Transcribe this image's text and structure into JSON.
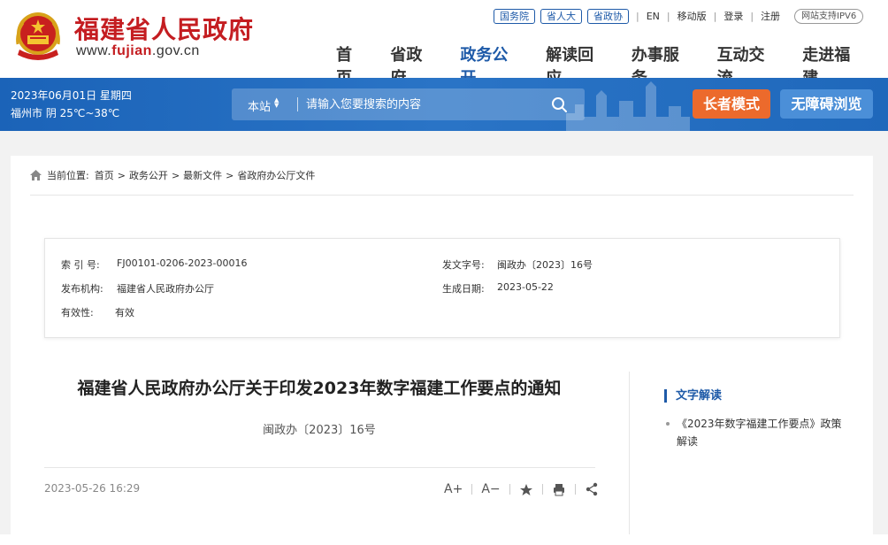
{
  "header": {
    "site_name": "福建省人民政府",
    "site_url_prefix": "www.",
    "site_url_brand": "fujian",
    "site_url_suffix": ".gov.cn",
    "top_pills": [
      "国务院",
      "省人大",
      "省政协"
    ],
    "lang_en": "EN",
    "mobile": "移动版",
    "login": "登录",
    "register": "注册",
    "ipv6": "网站支持IPV6",
    "nav": [
      {
        "label": "首页"
      },
      {
        "label": "省政府"
      },
      {
        "label": "政务公开",
        "active": true
      },
      {
        "label": "解读回应"
      },
      {
        "label": "办事服务"
      },
      {
        "label": "互动交流"
      },
      {
        "label": "走进福建"
      }
    ]
  },
  "bar": {
    "date_line": "2023年06月01日 星期四",
    "weather_line": "福州市 阴 25℃~38℃",
    "search_scope": "本站",
    "search_placeholder": "请输入您要搜索的内容",
    "elder_mode": "长者模式",
    "accessible": "无障碍浏览"
  },
  "breadcrumb": {
    "prefix": "当前位置:",
    "items": [
      "首页",
      "政务公开",
      "最新文件",
      "省政府办公厅文件"
    ]
  },
  "meta": {
    "index_label": "索 引 号:",
    "index_value": "FJ00101-0206-2023-00016",
    "doc_label": "发文字号:",
    "doc_value": "闽政办〔2023〕16号",
    "org_label": "发布机构:",
    "org_value": "福建省人民政府办公厅",
    "date_label": "生成日期:",
    "date_value": "2023-05-22",
    "validity_label": "有效性:",
    "validity_value": "有效"
  },
  "article": {
    "title": "福建省人民政府办公厅关于印发2023年数字福建工作要点的通知",
    "doc_number": "闽政办〔2023〕16号",
    "published": "2023-05-26 16:29",
    "font_up": "A+",
    "font_down": "A−"
  },
  "sidebar": {
    "heading": "文字解读",
    "items": [
      "《2023年数字福建工作要点》政策解读"
    ]
  },
  "colors": {
    "brand_red": "#c41d21",
    "brand_blue": "#1e5aa8",
    "elder_orange": "#ec6a2c"
  }
}
